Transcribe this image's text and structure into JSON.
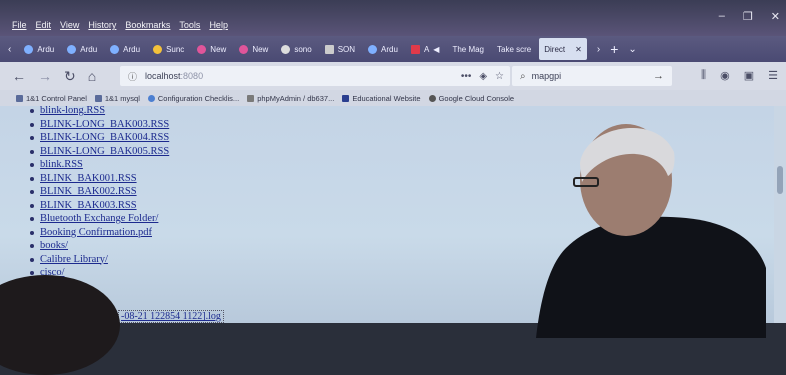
{
  "menu": [
    "File",
    "Edit",
    "View",
    "History",
    "Bookmarks",
    "Tools",
    "Help"
  ],
  "window_controls": [
    "–",
    "❐",
    "✕"
  ],
  "tabs": [
    {
      "label": "Ardu"
    },
    {
      "label": "Ardu"
    },
    {
      "label": "Ardu"
    },
    {
      "label": "Sunc"
    },
    {
      "label": "New"
    },
    {
      "label": "New"
    },
    {
      "label": "sono"
    },
    {
      "label": "SON"
    },
    {
      "label": "Ardu"
    },
    {
      "label": "A"
    },
    {
      "label": "The Mag"
    },
    {
      "label": "Take scre"
    },
    {
      "label": "Direct",
      "active": true
    }
  ],
  "tab_close": "✕",
  "new_tab": "+",
  "tab_overflow": "⌄",
  "nav": {
    "back": "←",
    "forward": "→",
    "reload": "↻",
    "home": "⌂"
  },
  "url": {
    "host": "localhost",
    "port": ":8080",
    "actions": "•••"
  },
  "search": {
    "value": "mapgpi",
    "go": "→"
  },
  "bookmarks": [
    {
      "label": "1&1 Control Panel"
    },
    {
      "label": "1&1 mysql"
    },
    {
      "label": "Configuration Checklis..."
    },
    {
      "label": "phpMyAdmin / db637..."
    },
    {
      "label": "Educational Website"
    },
    {
      "label": "Google Cloud Console"
    }
  ],
  "files": [
    "blink-long.RSS",
    "BLINK-LONG_BAK003.RSS",
    "BLINK-LONG_BAK004.RSS",
    "BLINK-LONG_BAK005.RSS",
    "blink.RSS",
    "BLINK_BAK001.RSS",
    "BLINK_BAK002.RSS",
    "BLINK_BAK003.RSS",
    "Bluetooth Exchange Folder/",
    "Booking Confirmation.pdf",
    "books/",
    "Calibre Library/",
    "cisco/"
  ],
  "bottom_file": "-08-21 122854 1122].log"
}
